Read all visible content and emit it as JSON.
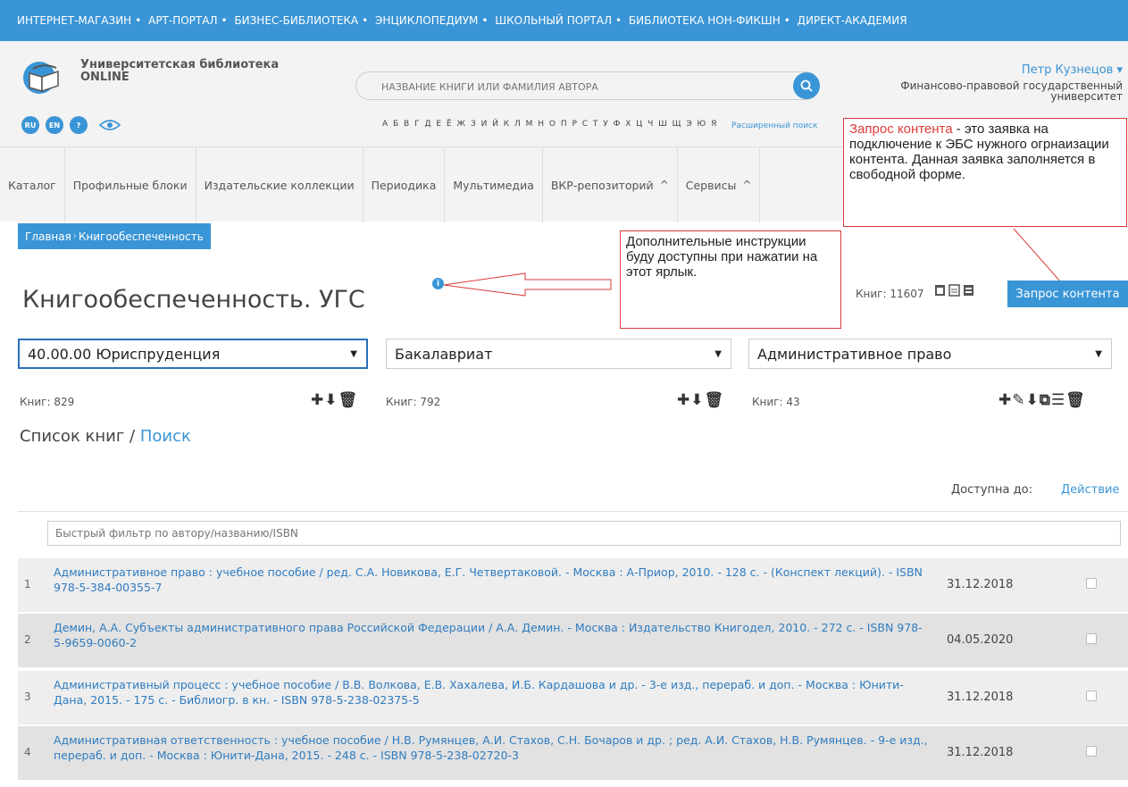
{
  "topbar": [
    "ИНТЕРНЕТ-МАГАЗИН",
    "АРТ-ПОРТАЛ",
    "БИЗНЕС-БИБЛИОТЕКА",
    "ЭНЦИКЛОПЕДИУМ",
    "ШКОЛЬНЫЙ ПОРТАЛ",
    "БИБЛИОТЕКА НОН-ФИКШН",
    "ДИРЕКТ-АКАДЕМИЯ"
  ],
  "header": {
    "logo_line1": "Университетская библиотека",
    "logo_line2": "ONLINE",
    "langs": [
      "RU",
      "EN",
      "?"
    ],
    "search_placeholder": "НАЗВАНИЕ КНИГИ ИЛИ ФАМИЛИЯ АВТОРА",
    "alphabet": "А Б В Г Д Е Ё Ж З И Й К Л М Н О П Р С Т У Ф Х Ц Ч Ш Щ Э Ю Я",
    "advanced_search": "Расширенный поиск",
    "user_name": "Петр Кузнецов ▾",
    "user_org": "Финансово-правовой государственный университет"
  },
  "nav": [
    "Каталог",
    "Профильные блоки",
    "Издательские коллекции",
    "Периодика",
    "Мультимедиа",
    "ВКР-репозиторий",
    "Сервисы"
  ],
  "breadcrumb": {
    "home": "Главная",
    "current": "Книгообеспеченность"
  },
  "page_title": "Книгообеспеченность. УГС",
  "info_icon_text": "i",
  "callouts": {
    "info": "Дополнительные инструкции буду доступны при нажатии на этот ярлык.",
    "content_red": "Запрос контента",
    "content_rest": " - это заявка на подключение к ЭБС нужного огрнаизации контента. Данная заявка заполняется в свободной форме."
  },
  "books_total": "Книг: 11607",
  "request_button": "Запрос контента",
  "selects": [
    {
      "value": "40.00.00 Юриспруденция",
      "count": "Книг: 829",
      "tools": "✚⬇🗑"
    },
    {
      "value": "Бакалавриат",
      "count": "Книг: 792",
      "tools": "✚⬇🗑"
    },
    {
      "value": "Административное право",
      "count": "Книг: 43",
      "tools": "✚✎⬇⧉☰🗑"
    }
  ],
  "list_title": "Список книг / ",
  "list_search_link": "Поиск",
  "table_header": {
    "date": "Доступна до:",
    "action": "Действие"
  },
  "filter_placeholder": "Быстрый фильтр по автору/названию/ISBN",
  "rows": [
    {
      "num": "1",
      "text": "Административное право : учебное пособие / ред. С.А. Новикова, Е.Г. Четвертаковой. - Москва : А-Приор, 2010. - 128 с. - (Конспект лекций). - ISBN 978-5-384-00355-7",
      "date": "31.12.2018"
    },
    {
      "num": "2",
      "text": "Демин, А.А. Субъекты административного права Российской Федерации / А.А. Демин. - Москва : Издательство Книгодел, 2010. - 272 с. - ISBN 978-5-9659-0060-2",
      "date": "04.05.2020"
    },
    {
      "num": "3",
      "text": "Административный процесс : учебное пособие / В.В. Волкова, Е.В. Хахалева, И.Б. Кардашова и др. - 3-е изд., перераб. и доп. - Москва : Юнити-Дана, 2015. - 175 с. - Библиогр. в кн. - ISBN 978-5-238-02375-5",
      "date": "31.12.2018"
    },
    {
      "num": "4",
      "text": "Административная ответственность : учебное пособие / Н.В. Румянцев, А.И. Стахов, С.Н. Бочаров и др. ; ред. А.И. Стахов, Н.В. Румянцев. - 9-е изд., перераб. и доп. - Москва : Юнити-Дана, 2015. - 248 с. - ISBN 978-5-238-02720-3",
      "date": "31.12.2018"
    }
  ],
  "colors": {
    "accent": "#3a95d6",
    "callout_border": "#d93b3b",
    "link": "#2f7cc0"
  }
}
